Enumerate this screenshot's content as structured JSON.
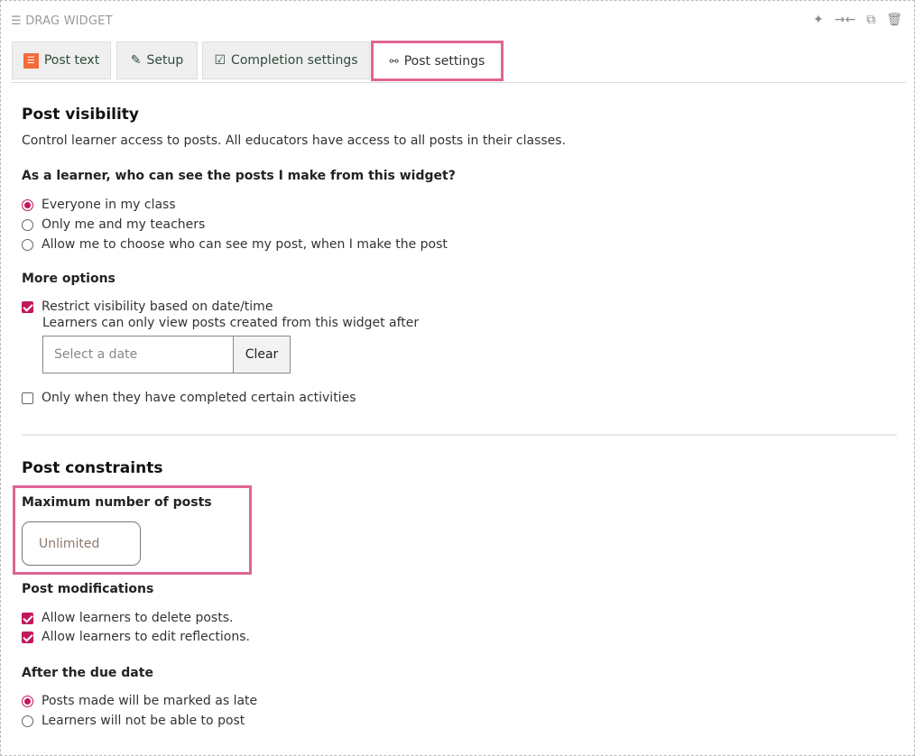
{
  "header": {
    "title": "DRAG WIDGET",
    "tools": [
      "magic-wand",
      "collapse",
      "duplicate",
      "delete"
    ]
  },
  "tabs": [
    {
      "label": "Post text"
    },
    {
      "label": "Setup"
    },
    {
      "label": "Completion settings"
    },
    {
      "label": "Post settings",
      "active": true
    }
  ],
  "visibility": {
    "title": "Post visibility",
    "description": "Control learner access to posts. All educators have access to all posts in their classes.",
    "question": "As a learner, who can see the posts I make from this widget?",
    "options": [
      {
        "label": "Everyone in my class",
        "selected": true
      },
      {
        "label": "Only me and my teachers",
        "selected": false
      },
      {
        "label": "Allow me to choose who can see my post, when I make the post",
        "selected": false
      }
    ]
  },
  "more_options": {
    "title": "More options",
    "restrict_label": "Restrict visibility based on date/time",
    "restrict_checked": true,
    "restrict_help": "Learners can only view posts created from this widget after",
    "date_placeholder": "Select a date",
    "clear_label": "Clear",
    "activities_label": "Only when they have completed certain activities",
    "activities_checked": false
  },
  "constraints": {
    "title": "Post constraints",
    "max_label": "Maximum number of posts",
    "max_placeholder": "Unlimited"
  },
  "modifications": {
    "title": "Post modifications",
    "items": [
      {
        "label": "Allow learners to delete posts.",
        "checked": true
      },
      {
        "label": "Allow learners to edit reflections.",
        "checked": true
      }
    ]
  },
  "due": {
    "title": "After the due date",
    "options": [
      {
        "label": "Posts made will be marked as late",
        "selected": true
      },
      {
        "label": "Learners will not be able to post",
        "selected": false
      }
    ]
  },
  "colors": {
    "accent": "#c2185b",
    "highlight": "#e06494"
  }
}
